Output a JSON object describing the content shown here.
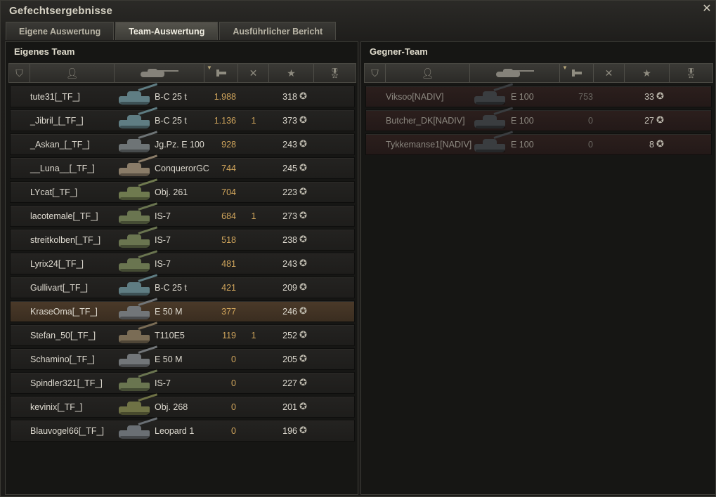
{
  "window": {
    "title": "Gefechtsergebnisse",
    "close_icon": "close-icon"
  },
  "tabs": [
    {
      "label": "Eigene Auswertung",
      "active": false
    },
    {
      "label": "Team-Auswertung",
      "active": true
    },
    {
      "label": "Ausführlicher Bericht",
      "active": false
    }
  ],
  "own_team": {
    "title": "Eigenes Team",
    "rows": [
      {
        "player": "tute31[_TF_]",
        "tank": "B-C 25 t",
        "damage": "1.988",
        "kills": "",
        "xp": "318",
        "tank_color": "#5f7d83"
      },
      {
        "player": "_Jibril_[_TF_]",
        "tank": "B-C 25 t",
        "damage": "1.136",
        "kills": "1",
        "xp": "373",
        "tank_color": "#5f7d83"
      },
      {
        "player": "_Askan_[_TF_]",
        "tank": "Jg.Pz. E 100",
        "damage": "928",
        "kills": "",
        "xp": "243",
        "tank_color": "#6e7476"
      },
      {
        "player": "__Luna__[_TF_]",
        "tank": "ConquerorGC",
        "damage": "744",
        "kills": "",
        "xp": "245",
        "tank_color": "#8a7c68"
      },
      {
        "player": "LYcat[_TF_]",
        "tank": "Obj. 261",
        "damage": "704",
        "kills": "",
        "xp": "223",
        "tank_color": "#6f7a4f"
      },
      {
        "player": "lacotemale[_TF_]",
        "tank": "IS-7",
        "damage": "684",
        "kills": "1",
        "xp": "273",
        "tank_color": "#6a7550"
      },
      {
        "player": "streitkolben[_TF_]",
        "tank": "IS-7",
        "damage": "518",
        "kills": "",
        "xp": "238",
        "tank_color": "#6a7550"
      },
      {
        "player": "Lyrix24[_TF_]",
        "tank": "IS-7",
        "damage": "481",
        "kills": "",
        "xp": "243",
        "tank_color": "#6a7550"
      },
      {
        "player": "Gullivart[_TF_]",
        "tank": "B-C 25 t",
        "damage": "421",
        "kills": "",
        "xp": "209",
        "tank_color": "#5f7d83"
      },
      {
        "player": "KraseOma[_TF_]",
        "tank": "E 50 M",
        "damage": "377",
        "kills": "",
        "xp": "246",
        "tank_color": "#727679",
        "highlight": true
      },
      {
        "player": "Stefan_50[_TF_]",
        "tank": "T110E5",
        "damage": "119",
        "kills": "1",
        "xp": "252",
        "tank_color": "#7a6c55"
      },
      {
        "player": "Schamino[_TF_]",
        "tank": "E 50 M",
        "damage": "0",
        "kills": "",
        "xp": "205",
        "tank_color": "#727679"
      },
      {
        "player": "Spindler321[_TF_]",
        "tank": "IS-7",
        "damage": "0",
        "kills": "",
        "xp": "227",
        "tank_color": "#6a7550"
      },
      {
        "player": "kevinix[_TF_]",
        "tank": "Obj. 268",
        "damage": "0",
        "kills": "",
        "xp": "201",
        "tank_color": "#6f7245"
      },
      {
        "player": "Blauvogel66[_TF_]",
        "tank": "Leopard 1",
        "damage": "0",
        "kills": "",
        "xp": "196",
        "tank_color": "#6a6f74"
      }
    ]
  },
  "enemy_team": {
    "title": "Gegner-Team",
    "rows": [
      {
        "player": "Viksoo[NADIV]",
        "tank": "E 100",
        "damage": "753",
        "kills": "",
        "xp": "33",
        "tank_color": "#3a3d40"
      },
      {
        "player": "Butcher_DK[NADIV]",
        "tank": "E 100",
        "damage": "0",
        "kills": "",
        "xp": "27",
        "tank_color": "#3a3d40"
      },
      {
        "player": "Tykkemanse1[NADIV]",
        "tank": "E 100",
        "damage": "0",
        "kills": "",
        "xp": "8",
        "tank_color": "#3a3d40"
      }
    ]
  },
  "columns": {
    "icons": [
      "squad-icon",
      "player-icon",
      "tank-icon",
      "damage-icon",
      "kills-icon",
      "xp-star-icon",
      "medal-icon"
    ],
    "sorted_column": "damage",
    "star_glyph": "✪"
  }
}
